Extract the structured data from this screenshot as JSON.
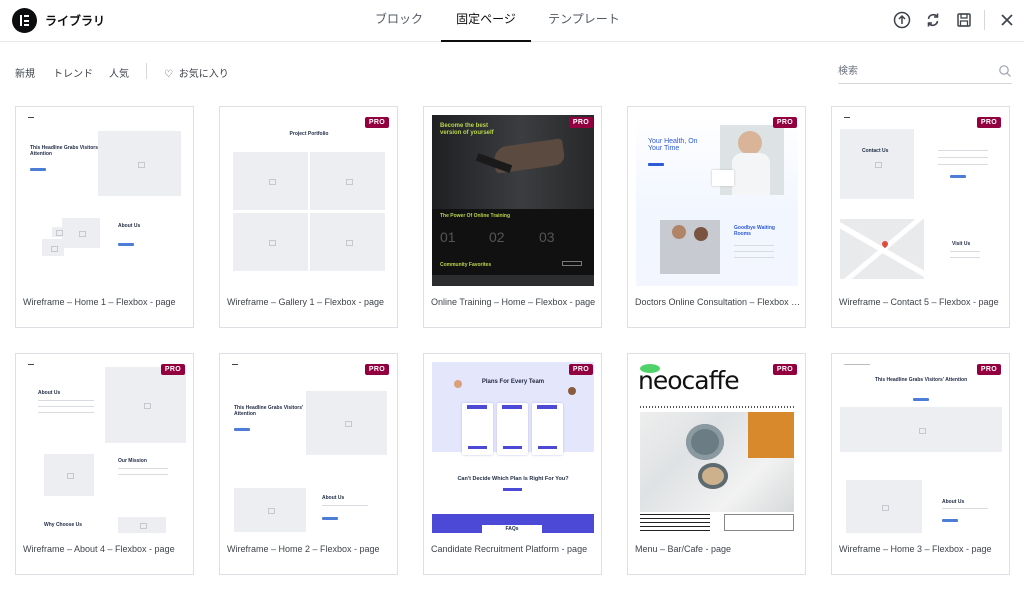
{
  "header": {
    "title": "ライブラリ",
    "tabs": [
      {
        "label": "ブロック",
        "active": false
      },
      {
        "label": "固定ページ",
        "active": true
      },
      {
        "label": "テンプレート",
        "active": false
      }
    ],
    "icons": [
      "upload-icon",
      "sync-icon",
      "save-icon",
      "close-icon"
    ]
  },
  "filters": {
    "items": [
      "新規",
      "トレンド",
      "人気"
    ],
    "favorites_label": "お気に入り"
  },
  "search": {
    "placeholder": "検索",
    "value": ""
  },
  "colors": {
    "pro_badge": "#93003f",
    "accent": "#0c0d0e"
  },
  "cards": [
    {
      "title": "Wireframe – Home 1 – Flexbox - page",
      "pro": false,
      "heading": "This Headline Grabs Visitors' Attention",
      "section": "About Us"
    },
    {
      "title": "Wireframe – Gallery 1 – Flexbox - page",
      "pro": true,
      "badge": "PRO",
      "heading": "Project Portfolio"
    },
    {
      "title": "Online Training – Home – Flexbox - page",
      "pro": true,
      "badge": "PRO",
      "heading": "Become the best version of yourself",
      "section": "The Power Of Online Training",
      "nums": [
        "01",
        "02",
        "03"
      ],
      "footer": "Community Favorites"
    },
    {
      "title": "Doctors Online Consultation – Flexbox - page",
      "pro": true,
      "badge": "PRO",
      "heading": "Your Health, On Your Time",
      "section": "Goodbye Waiting Rooms"
    },
    {
      "title": "Wireframe – Contact 5 – Flexbox - page",
      "pro": true,
      "badge": "PRO",
      "heading": "Contact Us",
      "section": "Visit Us"
    },
    {
      "title": "Wireframe – About 4 – Flexbox - page",
      "pro": true,
      "badge": "PRO",
      "heading": "About Us",
      "section": "Our Mission",
      "footer": "Why Choose Us"
    },
    {
      "title": "Wireframe – Home 2 – Flexbox - page",
      "pro": true,
      "badge": "PRO",
      "heading": "This Headline Grabs Visitors' Attention",
      "section": "About Us"
    },
    {
      "title": "Candidate Recruitment Platform - page",
      "pro": true,
      "badge": "PRO",
      "heading": "Plans For Every Team",
      "section": "Can't Decide Which Plan Is Right For You?",
      "footer": "FAQs"
    },
    {
      "title": "Menu – Bar/Cafe - page",
      "pro": true,
      "badge": "PRO",
      "heading": "neocaffe"
    },
    {
      "title": "Wireframe – Home 3 – Flexbox - page",
      "pro": true,
      "badge": "PRO",
      "heading": "This Headline Grabs Visitors' Attention",
      "section": "About Us"
    }
  ]
}
